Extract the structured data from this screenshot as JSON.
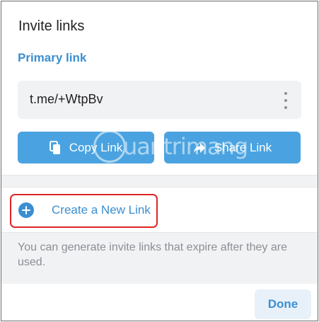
{
  "dialog": {
    "title": "Invite links",
    "section_label": "Primary link",
    "link_value": "t.me/+WtpBv",
    "copy_label": "Copy Link",
    "share_label": "Share Link",
    "create_label": "Create a New Link",
    "hint": "You can generate invite links that expire after they are used.",
    "done_label": "Done"
  },
  "icons": {
    "more": "more-vertical-icon",
    "copy": "copy-icon",
    "share": "share-arrow-icon",
    "add": "plus-circle-icon"
  },
  "watermark": {
    "text": "uantrimang"
  },
  "colors": {
    "accent": "#3a8fd1",
    "button_bg": "#4aa3e0",
    "highlight_border": "#e02424",
    "muted_text": "#8a8f95",
    "panel_bg": "#f1f2f4"
  }
}
